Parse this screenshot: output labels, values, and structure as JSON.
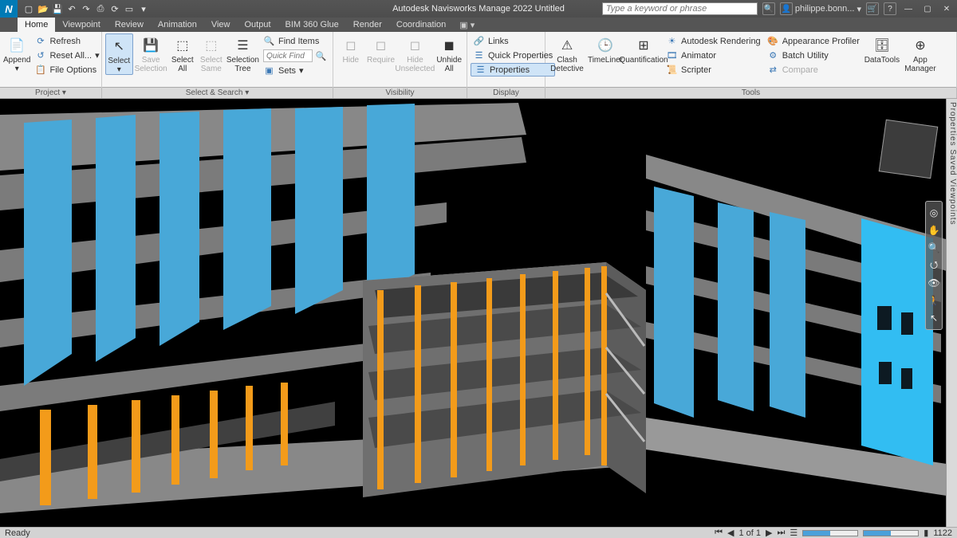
{
  "app_icon": "N",
  "title": "Autodesk Navisworks Manage 2022   Untitled",
  "search_placeholder": "Type a keyword or phrase",
  "user": "philippe.bonn...",
  "menu": {
    "tabs": [
      "Home",
      "Viewpoint",
      "Review",
      "Animation",
      "View",
      "Output",
      "BIM 360 Glue",
      "Render",
      "Coordination"
    ],
    "active": 0
  },
  "ribbon": {
    "project": {
      "append": "Append",
      "refresh": "Refresh",
      "reset": "Reset All...",
      "fileopt": "File Options",
      "label": "Project ▾"
    },
    "selsearch": {
      "select": "Select",
      "save": "Save\nSelection",
      "selall": "Select\nAll",
      "selsame": "Select\nSame",
      "seltree": "Selection\nTree",
      "find": "Find Items",
      "quickfind": "Quick Find",
      "sets": "Sets",
      "label": "Select & Search ▾"
    },
    "visibility": {
      "hide": "Hide",
      "require": "Require",
      "hideun": "Hide\nUnselected",
      "unhide": "Unhide\nAll",
      "label": "Visibility"
    },
    "display": {
      "links": "Links",
      "quickprops": "Quick Properties",
      "properties": "Properties",
      "label": "Display"
    },
    "tools": {
      "clash": "Clash\nDetective",
      "timeliner": "TimeLiner",
      "quant": "Quantification",
      "render": "Autodesk Rendering",
      "animator": "Animator",
      "scripter": "Scripter",
      "appprof": "Appearance Profiler",
      "batch": "Batch Utility",
      "compare": "Compare",
      "datatools": "DataTools",
      "appmgr": "App Manager",
      "label": "Tools"
    }
  },
  "side_panels": "Properties  Saved Viewpoints",
  "status": {
    "ready": "Ready",
    "pager": "1 of 1",
    "count": "1122"
  }
}
